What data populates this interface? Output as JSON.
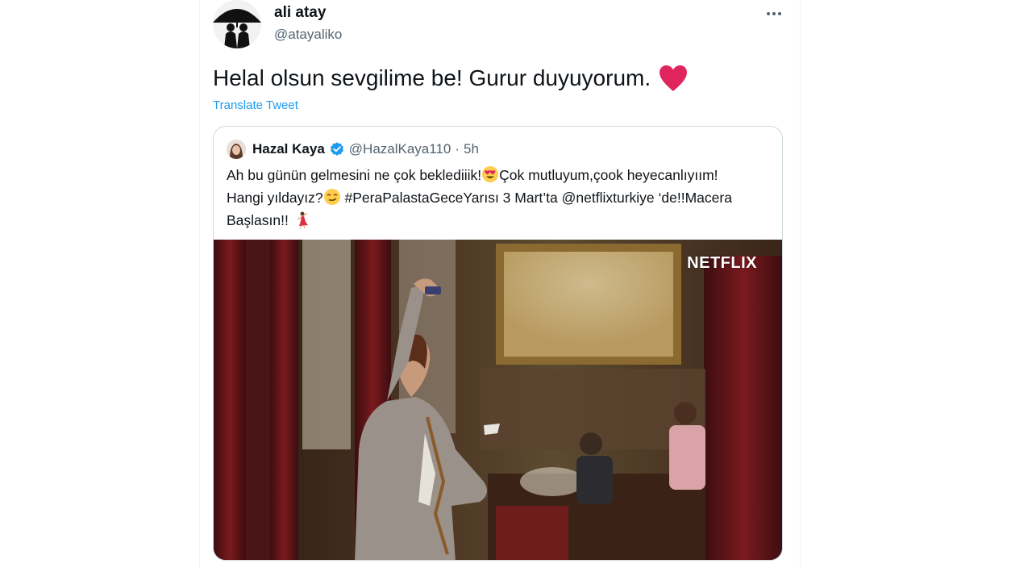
{
  "tweet": {
    "author_name": "ali atay",
    "author_handle": "@atayaliko",
    "text": "Helal olsun sevgilime be! Gurur duyuyorum.",
    "text_emoji": "red-heart",
    "translate_label": "Translate Tweet",
    "more_icon": "more-horizontal-icon"
  },
  "quoted": {
    "author_name": "Hazal Kaya",
    "verified": true,
    "author_handle": "@HazalKaya110",
    "separator": "·",
    "time": "5h",
    "line1_a": "Ah bu günün gelmesini ne çok beklediiik!",
    "line1_b": "Çok mutluyum,çook heyecanlıyıım!",
    "line2_a": "Hangi yıldayız?",
    "line2_b": " #PeraPalastaGeceYarısı 3 Mart’ta @netflixturkiye ‘de!!Macera",
    "line3": "Başlasın!!",
    "emojis": [
      "heart-eyes-emoji",
      "smirking-face-emoji",
      "dancer-emoji"
    ],
    "media_watermark": "NETFLIX"
  },
  "colors": {
    "link": "#1d9bf0",
    "secondary_text": "#536471",
    "heart": "#e0245e",
    "border": "#cfd9de"
  }
}
